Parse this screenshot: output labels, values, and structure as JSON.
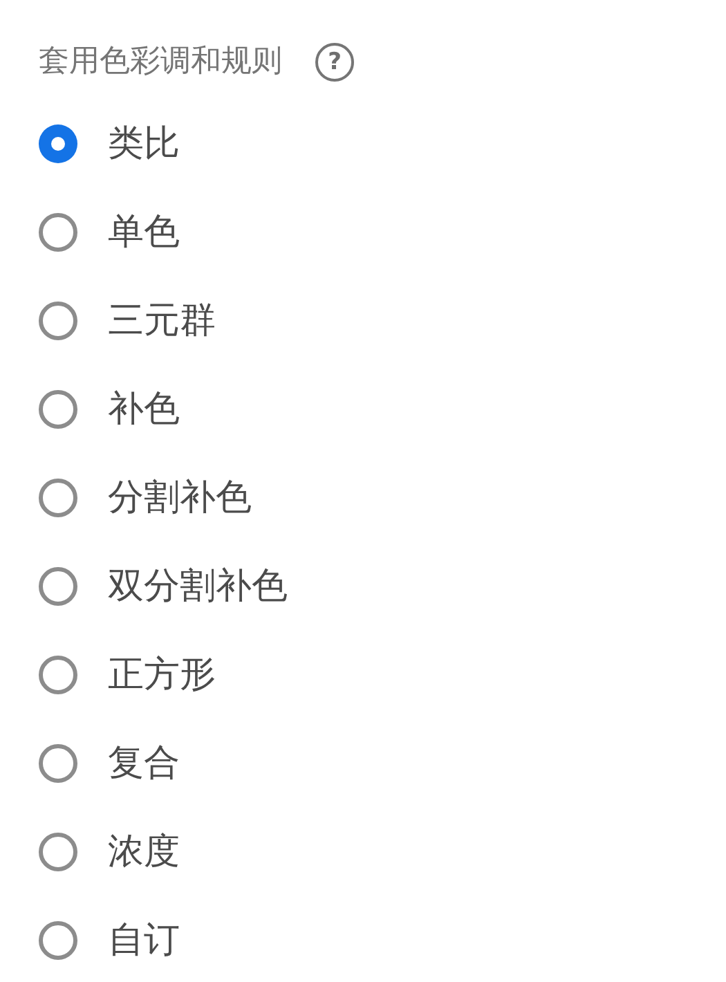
{
  "heading": {
    "title": "套用色彩调和规则",
    "help": "?"
  },
  "options": [
    {
      "label": "类比",
      "selected": true
    },
    {
      "label": "单色",
      "selected": false
    },
    {
      "label": "三元群",
      "selected": false
    },
    {
      "label": "补色",
      "selected": false
    },
    {
      "label": "分割补色",
      "selected": false
    },
    {
      "label": "双分割补色",
      "selected": false
    },
    {
      "label": "正方形",
      "selected": false
    },
    {
      "label": "复合",
      "selected": false
    },
    {
      "label": "浓度",
      "selected": false
    },
    {
      "label": "自订",
      "selected": false
    }
  ]
}
